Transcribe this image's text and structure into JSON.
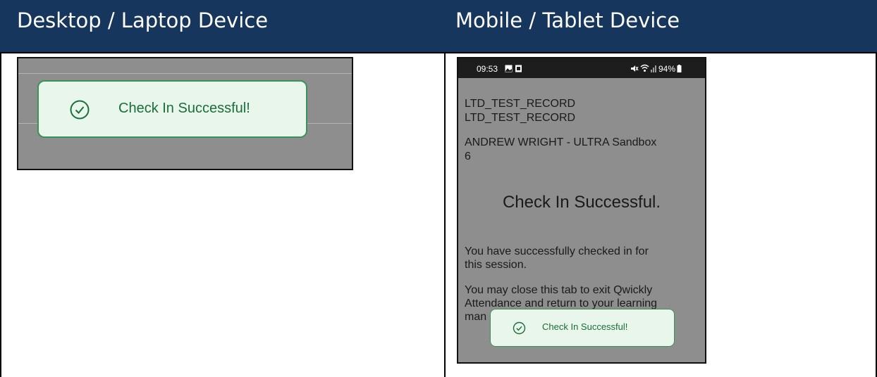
{
  "columns": {
    "desktop_header": "Desktop / Laptop Device",
    "mobile_header": "Mobile / Tablet Device"
  },
  "desktop": {
    "toast_message": "Check In Successful!"
  },
  "mobile": {
    "status_time": "09:53",
    "status_battery": "94%",
    "record_line1": "LTD_TEST_RECORD",
    "record_line2": "LTD_TEST_RECORD",
    "course_line1": "ANDREW WRIGHT - ULTRA Sandbox",
    "course_line2": "6",
    "heading": "Check In Successful.",
    "para1_line1": "You have successfully checked in for",
    "para1_line2": "this session.",
    "para2_line1": "You may close this tab to exit Qwickly",
    "para2_line2": "Attendance and return to your learning",
    "para2_line3_partial": "man",
    "toast_message": "Check In Successful!"
  },
  "colors": {
    "header_bg": "#17365d",
    "toast_bg": "#e8f6ec",
    "toast_border": "#3c9157",
    "toast_text": "#1a6e3a",
    "overlay_gray": "#8e8e8e"
  },
  "icons": [
    "check-circle-icon",
    "gallery-icon",
    "sim-icon",
    "mute-icon",
    "wifi-icon",
    "signal-icon",
    "battery-icon"
  ]
}
